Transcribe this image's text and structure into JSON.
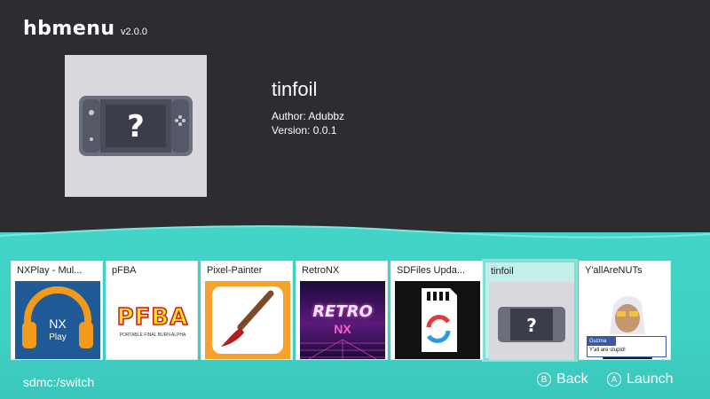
{
  "app": {
    "name": "hbmenu",
    "version": "v2.0.0"
  },
  "selected": {
    "title": "tinfoil",
    "author": "Author: Adubbz",
    "version": "Version: 0.0.1"
  },
  "tiles": [
    {
      "label": "NXPlay - Mul...",
      "icon": "headphones-icon",
      "art_text_1": "NX",
      "art_text_2": "Play"
    },
    {
      "label": "pFBA",
      "icon": "pfba-logo",
      "art_text_1": "PFBA",
      "art_text_2": "PORTABLE FINAL BURN ALPHA"
    },
    {
      "label": "Pixel-Painter",
      "icon": "paintbrush-icon"
    },
    {
      "label": "RetroNX",
      "icon": "retronx-logo",
      "art_text_1": "RETRO",
      "art_text_2": "NX"
    },
    {
      "label": "SDFiles Upda...",
      "icon": "sdcard-refresh-icon"
    },
    {
      "label": "tinfoil",
      "icon": "switch-console-icon"
    },
    {
      "label": "Y'allAreNUTs",
      "icon": "character-portrait",
      "art_text_1": "Guzma",
      "art_text_2": "Y'all are stupid!"
    }
  ],
  "footer": {
    "path": "sdmc:/switch",
    "back_glyph": "B",
    "back_label": "Back",
    "launch_glyph": "A",
    "launch_label": "Launch"
  },
  "colors": {
    "top_bg": "#2d2d31",
    "accent": "#43d4c8"
  }
}
